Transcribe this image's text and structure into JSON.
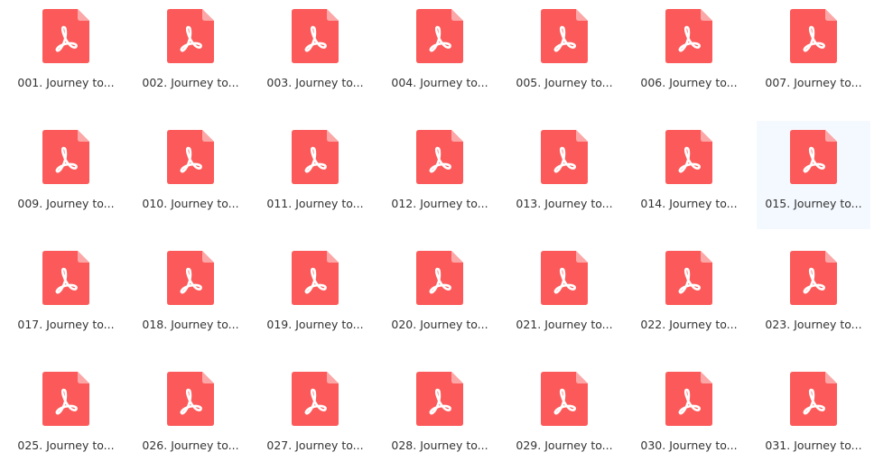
{
  "colors": {
    "file_icon": "#fc5a5a",
    "file_fold": "#fca7a7",
    "acrobat_glyph": "#ffffff",
    "selected_bg": "#f4f9ff",
    "label_text": "#333333"
  },
  "icon_name": "pdf-file-icon",
  "selected_index": 13,
  "files": [
    {
      "label": "001. Journey to..."
    },
    {
      "label": "002. Journey to..."
    },
    {
      "label": "003. Journey to..."
    },
    {
      "label": "004. Journey to..."
    },
    {
      "label": "005. Journey to..."
    },
    {
      "label": "006. Journey to..."
    },
    {
      "label": "007. Journey to..."
    },
    {
      "label": "009. Journey to..."
    },
    {
      "label": "010. Journey to..."
    },
    {
      "label": "011. Journey to..."
    },
    {
      "label": "012. Journey to..."
    },
    {
      "label": "013. Journey to..."
    },
    {
      "label": "014. Journey to..."
    },
    {
      "label": "015. Journey to..."
    },
    {
      "label": "017. Journey to..."
    },
    {
      "label": "018. Journey to..."
    },
    {
      "label": "019. Journey to..."
    },
    {
      "label": "020. Journey to..."
    },
    {
      "label": "021. Journey to..."
    },
    {
      "label": "022. Journey to..."
    },
    {
      "label": "023. Journey to..."
    },
    {
      "label": "025. Journey to..."
    },
    {
      "label": "026. Journey to..."
    },
    {
      "label": "027. Journey to..."
    },
    {
      "label": "028. Journey to..."
    },
    {
      "label": "029. Journey to..."
    },
    {
      "label": "030. Journey to..."
    },
    {
      "label": "031. Journey to..."
    }
  ]
}
